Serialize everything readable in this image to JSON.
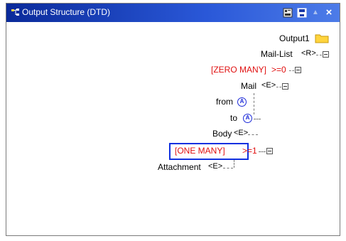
{
  "window": {
    "title": "Output Structure (DTD)",
    "buttons": [
      "save-icon",
      "disk-icon",
      "pin-icon",
      "close-icon"
    ]
  },
  "tree": {
    "root": {
      "label": "Output1",
      "icon": "folder-icon"
    },
    "mail_list": {
      "label": "Mail-List",
      "tag": "<R>"
    },
    "zero_many": {
      "label": "[ZERO MANY]",
      "suffix": ">=0"
    },
    "mail": {
      "label": "Mail",
      "tag": "<E>"
    },
    "from": {
      "label": "from",
      "attr_icon": "A"
    },
    "to": {
      "label": "to",
      "attr_icon": "A"
    },
    "body": {
      "label": "Body",
      "tag": "<E>"
    },
    "one_many": {
      "label": "[ONE MANY]",
      "suffix": ">=1"
    },
    "attachment": {
      "label": "Attachment",
      "tag": "<E>"
    }
  },
  "colors": {
    "cardinality": "#e01010",
    "highlight": "#1030e0",
    "attribute": "#1c2ad8"
  }
}
